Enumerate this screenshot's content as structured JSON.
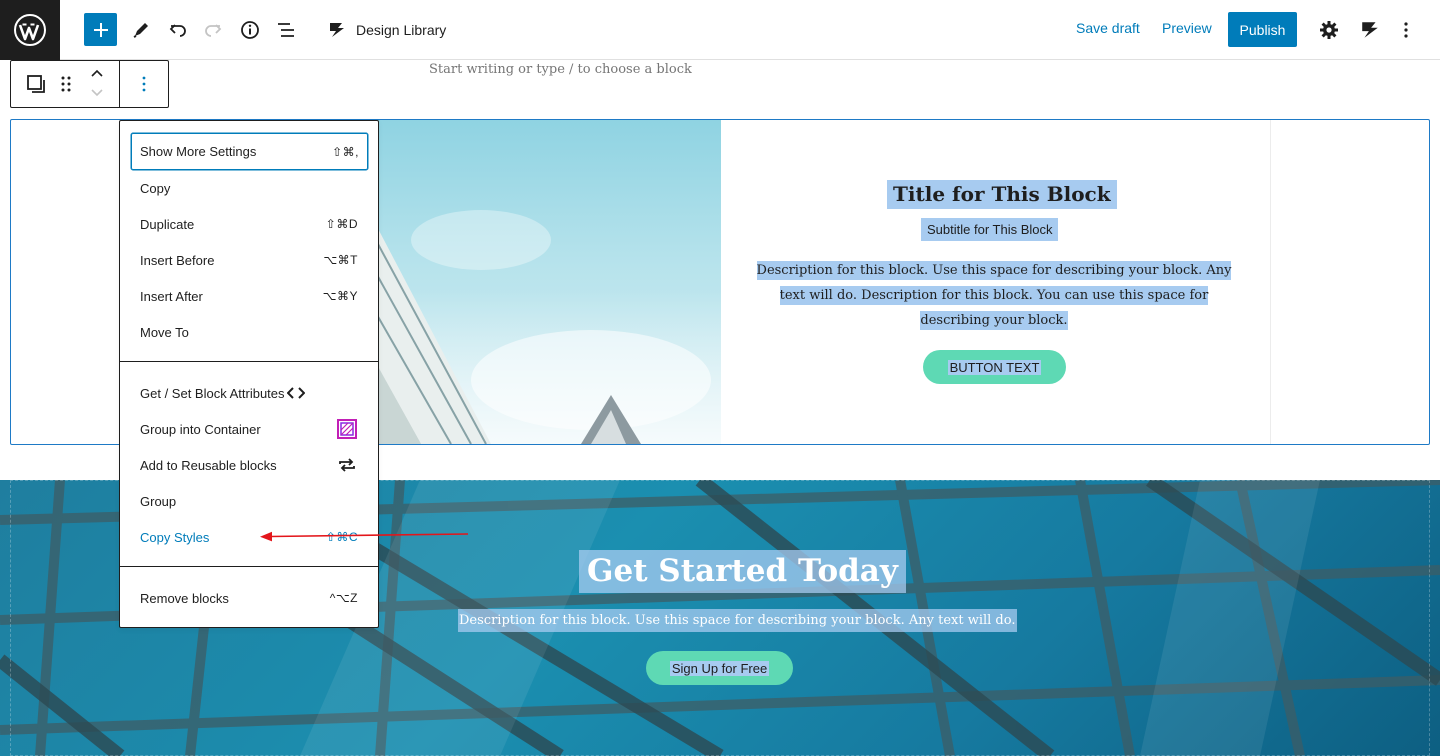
{
  "topbar": {
    "doc_title": "Design Library",
    "save_draft": "Save draft",
    "preview": "Preview",
    "publish": "Publish"
  },
  "editor": {
    "placeholder": "Start writing or type / to choose a block"
  },
  "block1": {
    "title": "Title for This Block",
    "subtitle": "Subtitle for This Block",
    "description": "Description for this block. Use this space for describing your block. Any text will do. Description for this block. You can use this space for describing your block.",
    "button": "BUTTON TEXT"
  },
  "hero": {
    "title": "Get Started Today",
    "description": "Description for this block. Use this space for describing your block. Any text will do.",
    "button": "Sign Up for Free"
  },
  "menu": {
    "show_more": {
      "label": "Show More Settings",
      "shortcut": "⇧⌘,"
    },
    "copy": {
      "label": "Copy"
    },
    "duplicate": {
      "label": "Duplicate",
      "shortcut": "⇧⌘D"
    },
    "insert_before": {
      "label": "Insert Before",
      "shortcut": "⌥⌘T"
    },
    "insert_after": {
      "label": "Insert After",
      "shortcut": "⌥⌘Y"
    },
    "move_to": {
      "label": "Move To"
    },
    "get_set": {
      "label": "Get / Set Block Attributes",
      "icon": "code-icon"
    },
    "group_container": {
      "label": "Group into Container",
      "icon": "container-icon"
    },
    "reusable": {
      "label": "Add to Reusable blocks",
      "icon": "reusable-icon"
    },
    "group": {
      "label": "Group"
    },
    "copy_styles": {
      "label": "Copy Styles",
      "shortcut": "⇧⌘C"
    },
    "remove": {
      "label": "Remove blocks",
      "shortcut": "^⌥Z"
    }
  },
  "colors": {
    "accent": "#007cba",
    "button_green": "#5ed9b4",
    "selection": "#a7cbf0",
    "annotation_arrow": "#e3161b"
  }
}
